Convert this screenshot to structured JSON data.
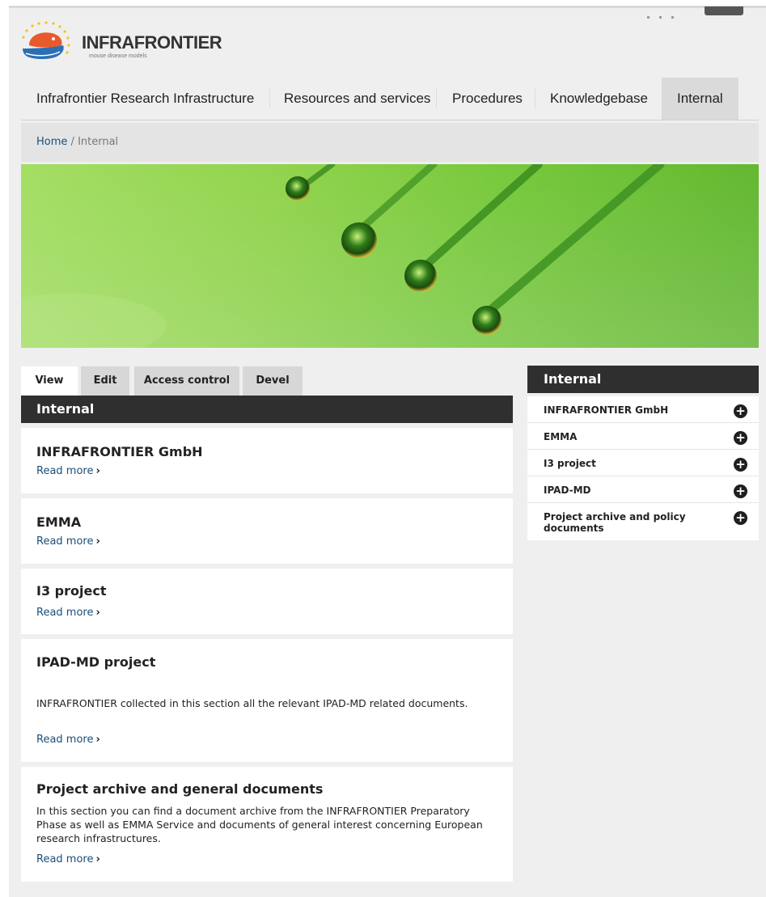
{
  "logo": {
    "title": "INFRAFRONTIER",
    "subtitle": "mouse disease models"
  },
  "main_nav": [
    {
      "label": "Infrafrontier Research Infrastructure"
    },
    {
      "label": "Resources and services"
    },
    {
      "label": "Procedures"
    },
    {
      "label": "Knowledgebase"
    },
    {
      "label": "Internal"
    }
  ],
  "breadcrumb": {
    "home": "Home",
    "separator": "/",
    "current": "Internal"
  },
  "tabs": [
    {
      "label": "View"
    },
    {
      "label": "Edit"
    },
    {
      "label": "Access control"
    },
    {
      "label": "Devel"
    }
  ],
  "content": {
    "title": "Internal",
    "read_more": "Read more",
    "read_more_icon": "chevron-right-icon",
    "items": [
      {
        "title": "INFRAFRONTIER GmbH"
      },
      {
        "title": "EMMA"
      },
      {
        "title": "I3 project"
      },
      {
        "title": "IPAD-MD project",
        "description": "INFRAFRONTIER collected in this section all the relevant IPAD-MD related documents."
      },
      {
        "title": "Project archive and general documents",
        "description": "In this section you can find a document archive from the INFRAFRONTIER Preparatory Phase as well as EMMA Service  and documents of general interest concerning European research infrastructures."
      }
    ]
  },
  "sidebar": {
    "title": "Internal",
    "expand_icon": "plus-circle-icon",
    "items": [
      {
        "label": "INFRAFRONTIER GmbH"
      },
      {
        "label": "EMMA"
      },
      {
        "label": "I3 project"
      },
      {
        "label": "IPAD-MD"
      },
      {
        "label": "Project archive and policy documents"
      }
    ]
  },
  "colors": {
    "accent_link": "#1a4f7a",
    "dark_header": "#2f2f2f",
    "hero_green": "#8ed24a"
  }
}
